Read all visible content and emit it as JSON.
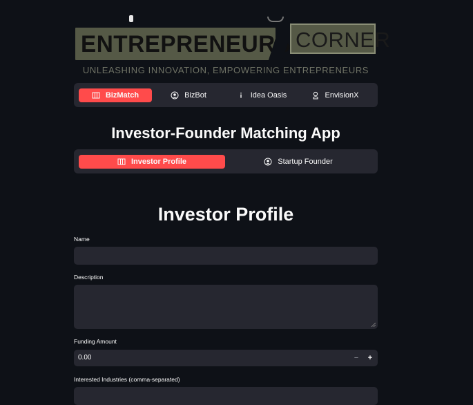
{
  "logo": {
    "left_text": "ENTREPRENEURS",
    "right_text": "CORNER",
    "tagline": "UNLEASHING INNOVATION, EMPOWERING ENTREPRENEURS"
  },
  "main_tabs": [
    {
      "label": "BizMatch",
      "icon": "map-icon",
      "active": true
    },
    {
      "label": "BizBot",
      "icon": "person-circle-icon",
      "active": false
    },
    {
      "label": "Idea Oasis",
      "icon": "info-icon",
      "active": false
    },
    {
      "label": "EnvisionX",
      "icon": "person-pin-icon",
      "active": false
    }
  ],
  "app_title": "Investor-Founder Matching App",
  "sub_tabs": [
    {
      "label": "Investor Profile",
      "icon": "map-icon",
      "active": true
    },
    {
      "label": "Startup Founder",
      "icon": "person-circle-icon",
      "active": false
    }
  ],
  "page_title": "Investor Profile",
  "form": {
    "name_label": "Name",
    "name_value": "",
    "description_label": "Description",
    "description_value": "",
    "funding_label": "Funding Amount",
    "funding_value": "0.00",
    "minus": "−",
    "plus": "+",
    "industries_label": "Interested Industries (comma-separated)"
  },
  "colors": {
    "background": "#0e1117",
    "panel": "#262730",
    "accent": "#ff4b4b",
    "logo_green": "#555946"
  }
}
